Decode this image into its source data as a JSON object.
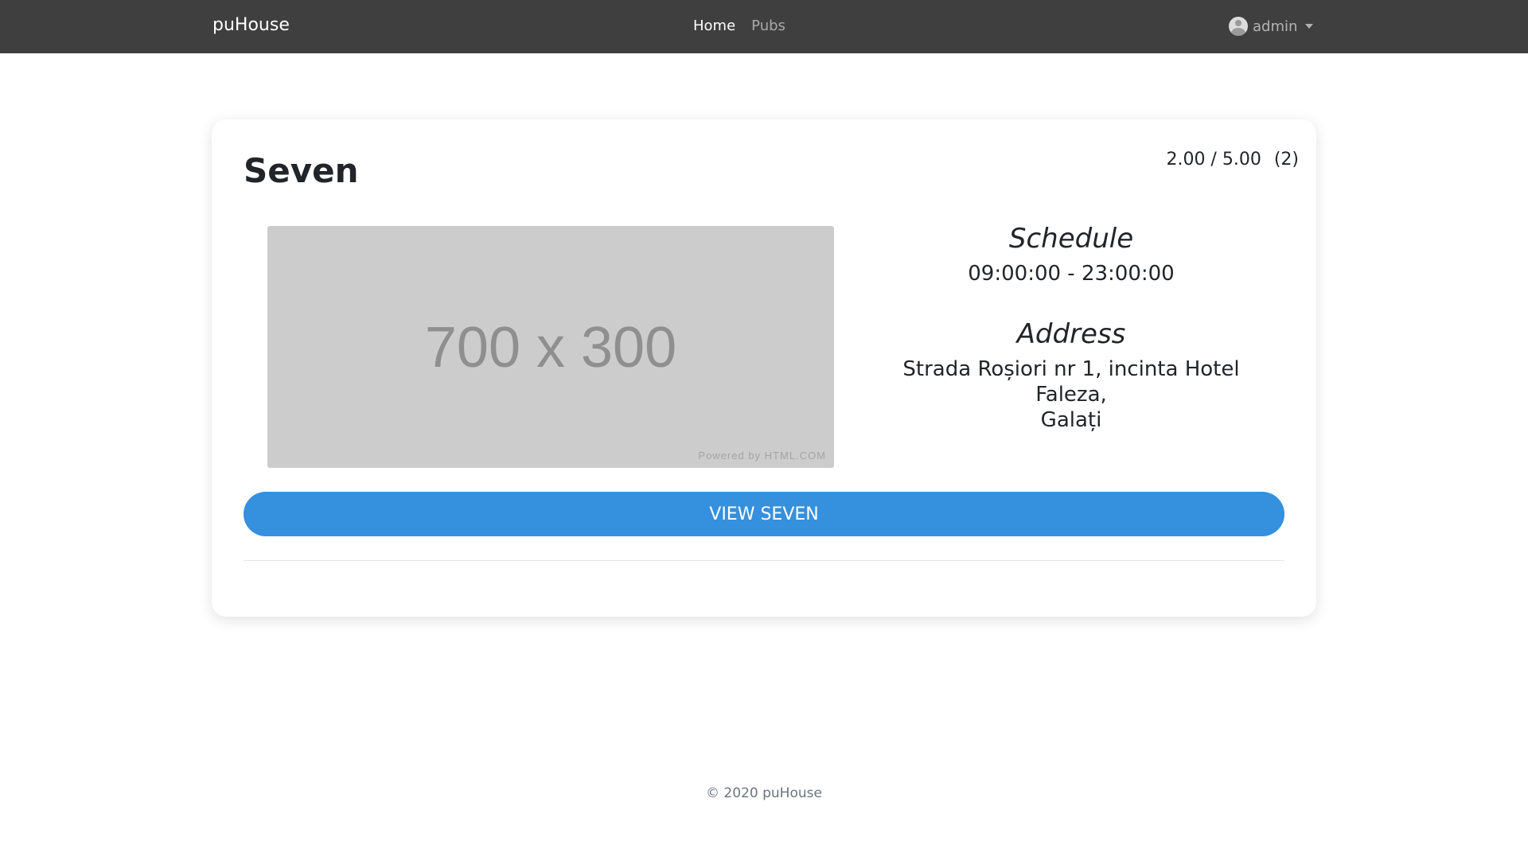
{
  "navbar": {
    "brand": "puHouse",
    "links": [
      {
        "label": "Home",
        "active": true
      },
      {
        "label": "Pubs",
        "active": false
      }
    ],
    "user": {
      "name": "admin",
      "icon": "user-avatar-icon"
    }
  },
  "pub": {
    "name": "Seven",
    "rating": "2.00 / 5.00",
    "rating_count": "(2)",
    "image": {
      "dimensions_text": "700 x 300",
      "powered_text": "Powered by HTML.COM"
    },
    "schedule_label": "Schedule",
    "schedule": "09:00:00 - 23:00:00",
    "address_label": "Address",
    "address_line1": "Strada Roșiori nr 1, incinta Hotel Faleza,",
    "address_line2": "Galați",
    "view_button": "VIEW SEVEN"
  },
  "footer": {
    "copyright": "© 2020 puHouse"
  },
  "colors": {
    "navbar": "#3f3f3f",
    "button": "#3590de",
    "placeholder": "#cccccc"
  }
}
